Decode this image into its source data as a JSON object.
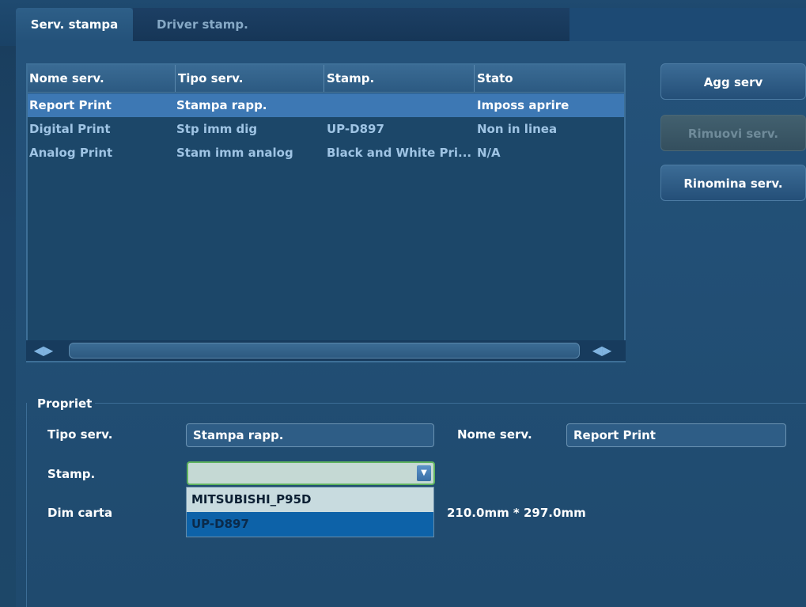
{
  "tabs": [
    {
      "label": "Serv. stampa",
      "active": true
    },
    {
      "label": "Driver stamp.",
      "active": false
    }
  ],
  "server_list": {
    "columns": [
      "Nome serv.",
      "Tipo serv.",
      "Stamp.",
      "Stato"
    ],
    "rows": [
      {
        "name": "Report Print",
        "type": "Stampa rapp.",
        "printer": "",
        "status": "Imposs aprire",
        "selected": true
      },
      {
        "name": "Digital Print",
        "type": "Stp imm dig",
        "printer": "UP-D897",
        "status": "Non in linea",
        "selected": false
      },
      {
        "name": "Analog Print",
        "type": "Stam imm analog",
        "printer": "Black and White Pri...",
        "status": "N/A",
        "selected": false
      }
    ],
    "scroll_left_icon": "◀▶",
    "scroll_right_icon": "◀▶"
  },
  "buttons": {
    "add": "Agg serv",
    "remove": "Rimuovi serv.",
    "rename": "Rinomina serv."
  },
  "properties": {
    "title": "Propriet",
    "service_type_label": "Tipo serv.",
    "service_type_value": "Stampa rapp.",
    "service_name_label": "Nome serv.",
    "service_name_value": "Report Print",
    "printer_label": "Stamp.",
    "printer_value": "",
    "printer_options": [
      "MITSUBISHI_P95D",
      "UP-D897"
    ],
    "paper_size_label": "Dim carta",
    "paper_size_value": "210.0mm * 297.0mm"
  },
  "colors": {
    "background": "#1d4768",
    "selected_row": "#3d78b4",
    "dropdown_highlight": "#0d62a8",
    "combo_focus_border": "#5fb35f"
  }
}
